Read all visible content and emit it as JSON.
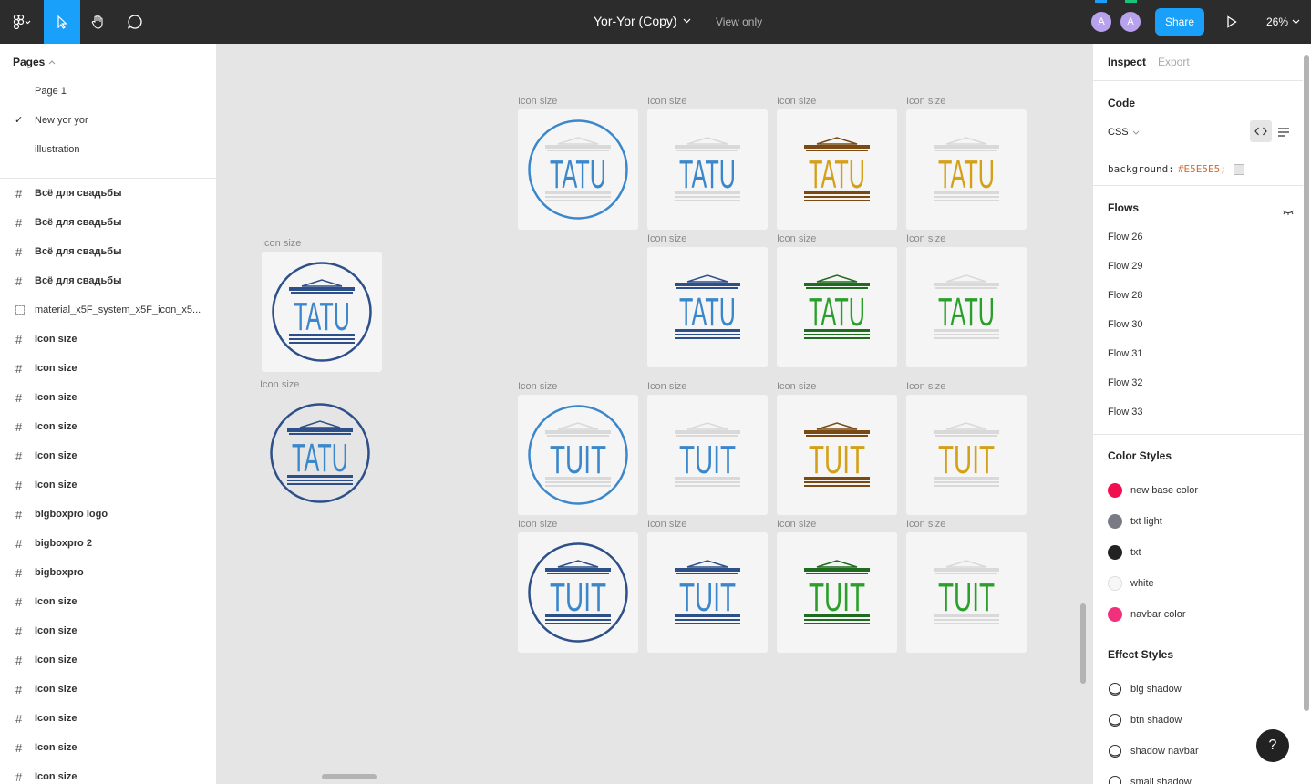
{
  "toolbar": {
    "title": "Yor-Yor (Copy)",
    "view_only": "View only",
    "avatars": [
      "A",
      "A"
    ],
    "share": "Share",
    "zoom": "26%"
  },
  "pages": {
    "heading": "Pages",
    "items": [
      "Page 1",
      "New yor yor",
      "illustration"
    ],
    "selected": 1
  },
  "layers": [
    {
      "name": "Всё для свадьбы",
      "icon": "frame"
    },
    {
      "name": "Всё для свадьбы",
      "icon": "frame"
    },
    {
      "name": "Всё для свадьбы",
      "icon": "frame"
    },
    {
      "name": "Всё для свадьбы",
      "icon": "frame"
    },
    {
      "name": "material_x5F_system_x5F_icon_x5...",
      "icon": "group"
    },
    {
      "name": "Icon size",
      "icon": "frame"
    },
    {
      "name": "Icon size",
      "icon": "frame"
    },
    {
      "name": "Icon size",
      "icon": "frame"
    },
    {
      "name": "Icon size",
      "icon": "frame"
    },
    {
      "name": "Icon size",
      "icon": "frame"
    },
    {
      "name": "Icon size",
      "icon": "frame"
    },
    {
      "name": "bigboxpro logo",
      "icon": "frame"
    },
    {
      "name": "bigboxpro  2",
      "icon": "frame"
    },
    {
      "name": "bigboxpro",
      "icon": "frame"
    },
    {
      "name": "Icon size",
      "icon": "frame"
    },
    {
      "name": "Icon size",
      "icon": "frame"
    },
    {
      "name": "Icon size",
      "icon": "frame"
    },
    {
      "name": "Icon size",
      "icon": "frame"
    },
    {
      "name": "Icon size",
      "icon": "frame"
    },
    {
      "name": "Icon size",
      "icon": "frame"
    },
    {
      "name": "Icon size",
      "icon": "frame"
    }
  ],
  "canvas": {
    "frame_label": "Icon size",
    "tiles": [
      {
        "text": "TATU",
        "letters": "#3b87cc",
        "roof": "#d9d9d9",
        "lines": "#d9d9d9",
        "ring": "#3b87cc"
      },
      {
        "text": "TATU",
        "letters": "#3b87cc",
        "roof": "#d9d9d9",
        "lines": "#d9d9d9",
        "ring": ""
      },
      {
        "text": "TATU",
        "letters": "#d4a017",
        "roof": "#7a4a12",
        "lines": "#7a4a12",
        "ring": ""
      },
      {
        "text": "TATU",
        "letters": "#d4a017",
        "roof": "#d9d9d9",
        "lines": "#d9d9d9",
        "ring": ""
      },
      {
        "text": "TATU",
        "letters": "#3b87cc",
        "roof": "#2d4f8a",
        "lines": "#2d4f8a",
        "ring": ""
      },
      {
        "text": "TATU",
        "letters": "#2aa02a",
        "roof": "#1f6b1f",
        "lines": "#1f6b1f",
        "ring": ""
      },
      {
        "text": "TATU",
        "letters": "#2aa02a",
        "roof": "#d9d9d9",
        "lines": "#d9d9d9",
        "ring": ""
      },
      {
        "text": "TATU",
        "letters": "#3b87cc",
        "roof": "#2d4f8a",
        "lines": "#2d4f8a",
        "ring": "#2d4f8a"
      },
      {
        "text": "TATU",
        "letters": "#3b87cc",
        "roof": "#2d4f8a",
        "lines": "#2d4f8a",
        "ring": "#2d4f8a"
      },
      {
        "text": "TUIT",
        "letters": "#3b87cc",
        "roof": "#d9d9d9",
        "lines": "#d9d9d9",
        "ring": "#3b87cc"
      },
      {
        "text": "TUIT",
        "letters": "#3b87cc",
        "roof": "#d9d9d9",
        "lines": "#d9d9d9",
        "ring": ""
      },
      {
        "text": "TUIT",
        "letters": "#d4a017",
        "roof": "#7a4a12",
        "lines": "#7a4a12",
        "ring": ""
      },
      {
        "text": "TUIT",
        "letters": "#d4a017",
        "roof": "#d9d9d9",
        "lines": "#d9d9d9",
        "ring": ""
      },
      {
        "text": "TUIT",
        "letters": "#3b87cc",
        "roof": "#2d4f8a",
        "lines": "#2d4f8a",
        "ring": "#2d4f8a"
      },
      {
        "text": "TUIT",
        "letters": "#3b87cc",
        "roof": "#2d4f8a",
        "lines": "#2d4f8a",
        "ring": ""
      },
      {
        "text": "TUIT",
        "letters": "#2aa02a",
        "roof": "#1f6b1f",
        "lines": "#1f6b1f",
        "ring": ""
      },
      {
        "text": "TUIT",
        "letters": "#2aa02a",
        "roof": "#d9d9d9",
        "lines": "#d9d9d9",
        "ring": ""
      }
    ]
  },
  "inspect": {
    "tab_inspect": "Inspect",
    "tab_export": "Export",
    "code_heading": "Code",
    "code_lang": "CSS",
    "css_prop": "background:",
    "css_value": "#E5E5E5;",
    "flows_heading": "Flows",
    "flows": [
      "Flow 26",
      "Flow 29",
      "Flow 28",
      "Flow 30",
      "Flow 31",
      "Flow 32",
      "Flow 33"
    ],
    "color_styles_heading": "Color Styles",
    "color_styles": [
      {
        "name": "new base color",
        "color": "#f0104f"
      },
      {
        "name": "txt light",
        "color": "#7a7a85"
      },
      {
        "name": "txt",
        "color": "#222222"
      },
      {
        "name": "white",
        "color": "#f7f7f7"
      },
      {
        "name": "navbar color",
        "color": "#f0307a"
      }
    ],
    "effect_styles_heading": "Effect Styles",
    "effect_styles": [
      "big shadow",
      "btn shadow",
      "shadow navbar",
      "small shadow"
    ]
  },
  "help": "?"
}
